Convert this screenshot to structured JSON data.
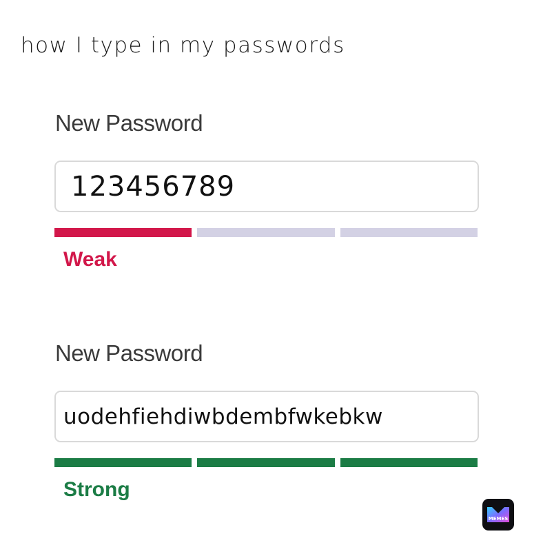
{
  "caption": "how I type in my passwords",
  "forms": [
    {
      "label": "New Password",
      "value": "123456789",
      "strength": "Weak",
      "strength_color": "#d2174a",
      "filled_segments": 1,
      "total_segments": 3
    },
    {
      "label": "New Password",
      "value": "uodehfiehdiwbdembfwkebkw",
      "strength": "Strong",
      "strength_color": "#1b7c45",
      "filled_segments": 3,
      "total_segments": 3
    }
  ],
  "colors": {
    "empty_segment": "#d3d1e4",
    "input_border": "#d9d9d9"
  },
  "watermark": {
    "icon": "memes-app-icon",
    "text": "MEMES"
  }
}
